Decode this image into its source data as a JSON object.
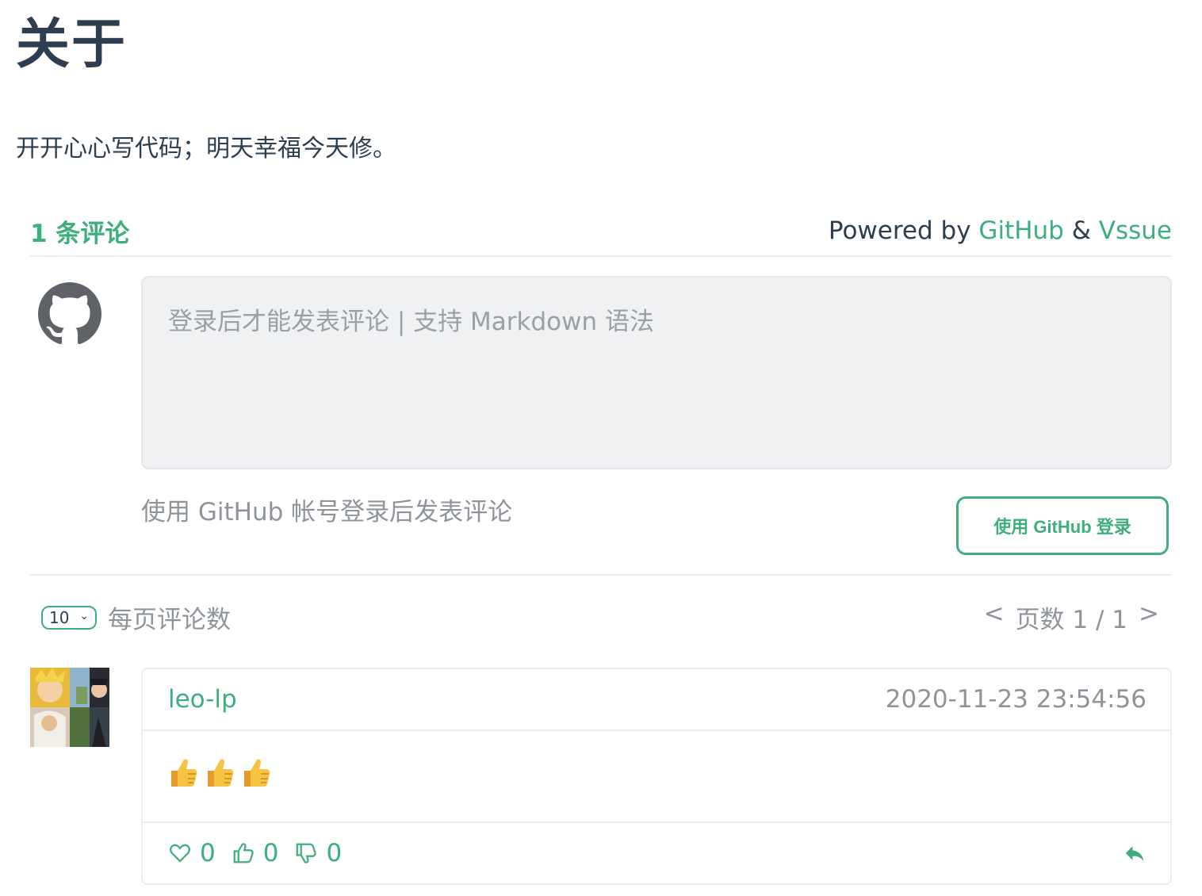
{
  "page": {
    "title": "关于",
    "description": "开开心心写代码；明天幸福今天修。"
  },
  "vssue": {
    "comment_count": "1 条评论",
    "powered_prefix": "Powered by",
    "powered_github": "GitHub",
    "powered_amp": "&",
    "powered_vssue": "Vssue",
    "editor_placeholder": "登录后才能发表评论 | 支持 Markdown 语法",
    "login_hint": "使用 GitHub 帐号登录后发表评论",
    "login_button": "使用 GitHub 登录",
    "per_page_value": "10",
    "per_page_label": "每页评论数",
    "pager": {
      "prev": "<",
      "label": "页数 1 / 1",
      "next": ">"
    },
    "comments": [
      {
        "author": "leo-lp",
        "timestamp": "2020-11-23 23:54:56",
        "body_emoji": "thumbs-up x3",
        "hearts": "0",
        "likes": "0",
        "dislikes": "0"
      }
    ]
  },
  "colors": {
    "accent": "#3eaf7c",
    "text": "#2c3e50",
    "muted": "#8e9499",
    "border": "#eaecef",
    "editor_bg": "#f0f1f3"
  },
  "icons": [
    "github-icon",
    "chevron-down-icon",
    "heart-icon",
    "thumbs-up-icon",
    "thumbs-down-icon",
    "reply-icon",
    "thumbs-up-emoji"
  ]
}
